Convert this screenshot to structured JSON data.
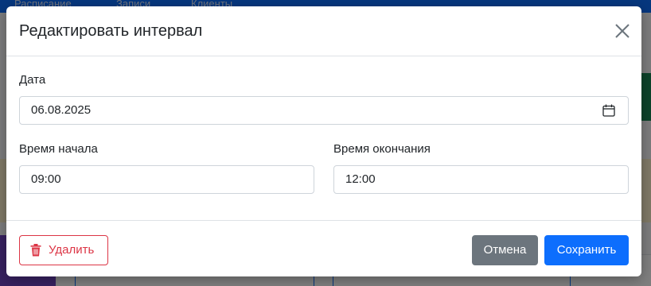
{
  "background": {
    "nav": {
      "items": [
        "Расписание",
        "Записи",
        "Клиенты"
      ]
    }
  },
  "modal": {
    "title": "Редактировать интервал",
    "date": {
      "label": "Дата",
      "value": "06.08.2025"
    },
    "start_time": {
      "label": "Время начала",
      "value": "09:00"
    },
    "end_time": {
      "label": "Время окончания",
      "value": "12:00"
    },
    "buttons": {
      "delete": "Удалить",
      "cancel": "Отмена",
      "save": "Сохранить"
    }
  },
  "colors": {
    "primary": "#0d6efd",
    "danger": "#dc3545",
    "secondary": "#6c757d"
  },
  "icons": {
    "close": "close-icon",
    "calendar": "calendar-icon",
    "delete": "trash-icon"
  }
}
